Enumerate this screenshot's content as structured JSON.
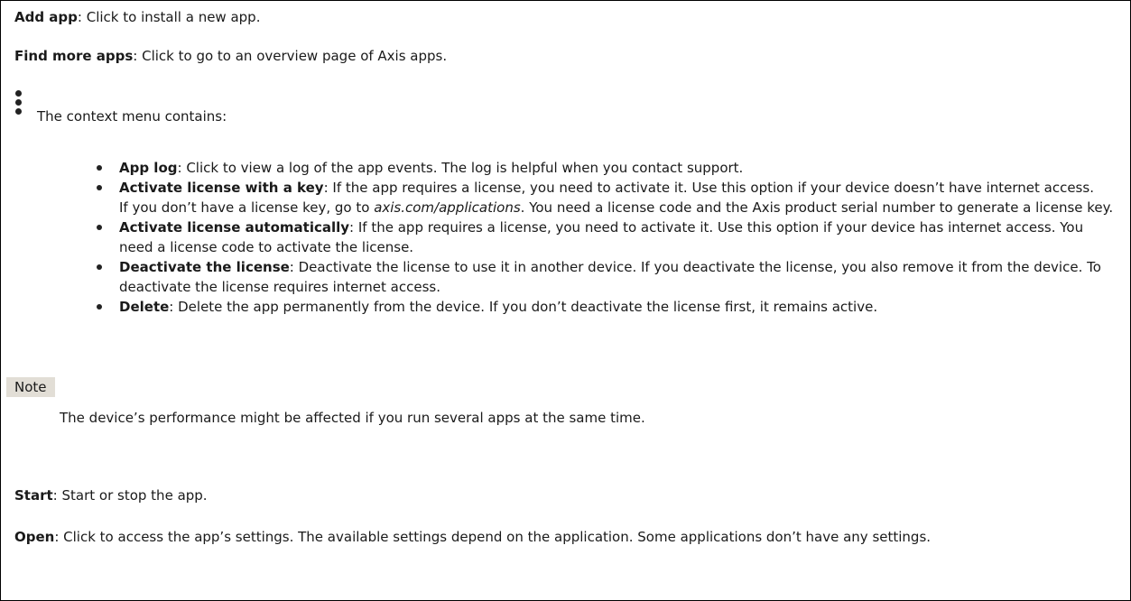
{
  "add_app": {
    "label": "Add app",
    "text": ": Click to install a new app."
  },
  "find_more": {
    "label": "Find more apps",
    "text": ": Click to go to an overview page of Axis apps."
  },
  "context_menu": {
    "icon": "kebab-menu-icon",
    "intro": "The context menu contains:"
  },
  "items": [
    {
      "label": "App log",
      "text": ": Click to view a log of the app events. The log is helpful when you contact support."
    },
    {
      "label": "Activate license with a key",
      "text": ": If the app requires a license, you need to activate it. Use this option if your device doesn’t have internet access.",
      "extra_before": "If you don’t have a license key, go to ",
      "extra_link": "axis.com/applications",
      "extra_after": ". You need a license code and the Axis product serial number to generate a license key."
    },
    {
      "label": "Activate license automatically",
      "text": ": If the app requires a license, you need to activate it. Use this option if your device has internet access. You need a license code to activate the license."
    },
    {
      "label": "Deactivate the license",
      "text": ": Deactivate the license to use it in another device. If you deactivate the license, you also remove it from the device. To deactivate the license requires internet access."
    },
    {
      "label": "Delete",
      "text": ": Delete the app permanently from the device. If you don’t deactivate the license first, it remains active."
    }
  ],
  "note": {
    "label": "Note",
    "text": "The device’s performance might be affected if you run several apps at the same time."
  },
  "start": {
    "label": "Start",
    "text": ": Start or stop the app."
  },
  "open": {
    "label": "Open",
    "text": ": Click to access the app’s settings. The available settings depend on the application. Some applications don’t have any settings."
  }
}
